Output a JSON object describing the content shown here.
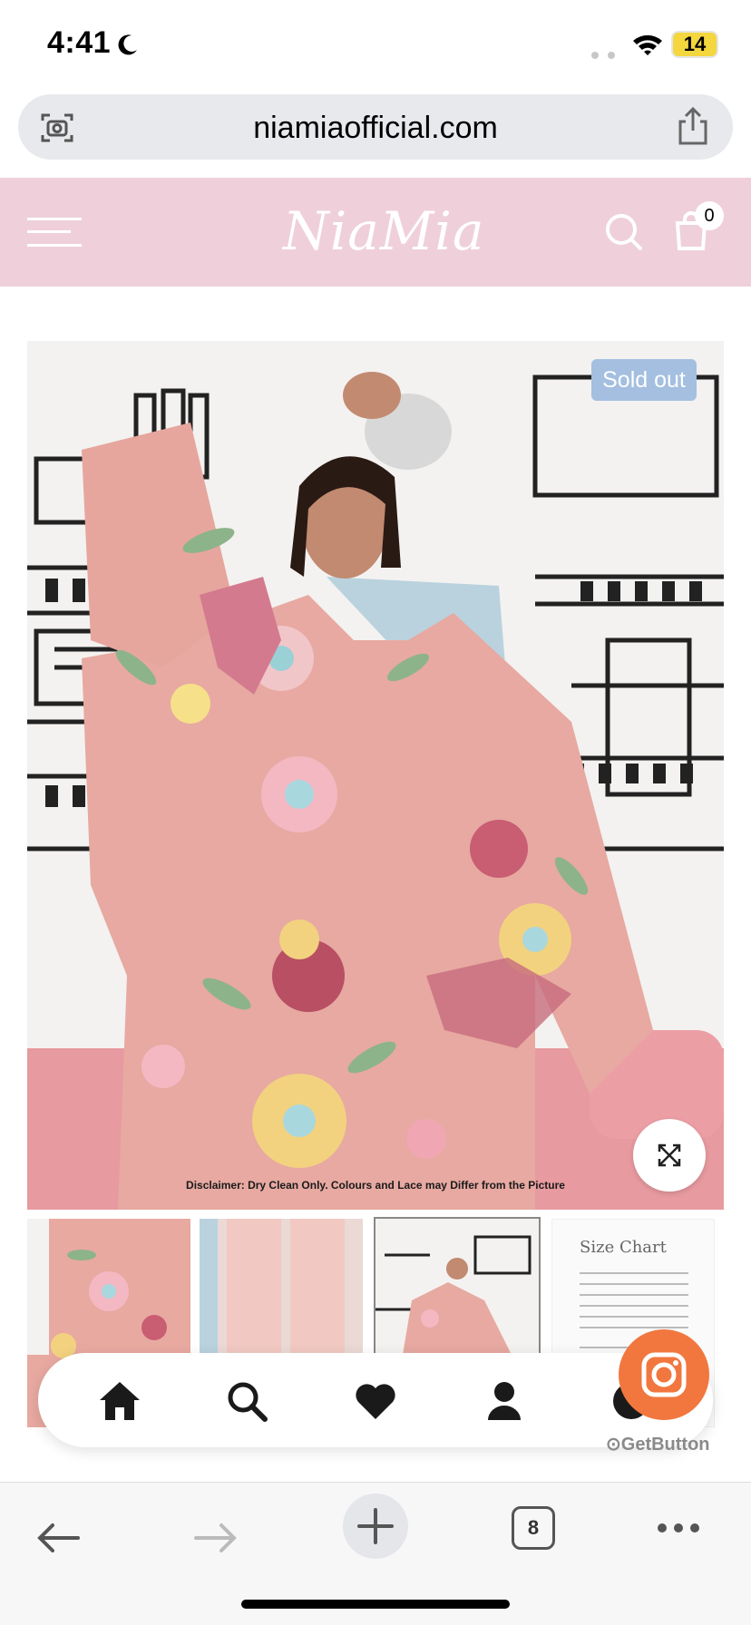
{
  "status_bar": {
    "time": "4:41",
    "battery": "14"
  },
  "browser": {
    "url": "niamiaofficial.com",
    "tab_count": "8"
  },
  "header": {
    "logo_text": "NiaMia",
    "cart_count": "0"
  },
  "product": {
    "badge": "Sold out",
    "disclaimer": "Disclaimer: Dry Clean Only. Colours and Lace may Differ from the Picture",
    "size_chart_thumb_title": "Size Chart"
  },
  "widget": {
    "provider": "GetButton"
  },
  "colors": {
    "header_bg": "#efd0da",
    "badge_bg": "#a4bfe0",
    "instagram_bg": "#f1773f"
  }
}
